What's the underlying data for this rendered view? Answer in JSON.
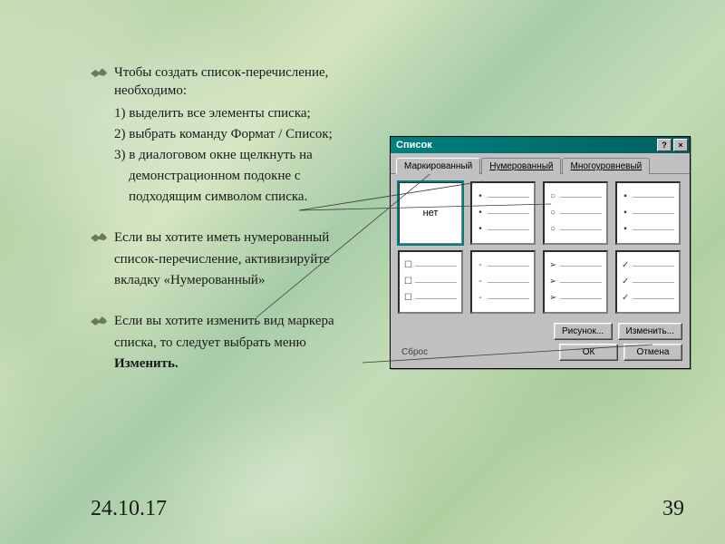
{
  "slide": {
    "bullets": [
      {
        "lead": "Чтобы создать список-перечисление, необходимо:",
        "items": [
          "1) выделить все элементы списка;",
          "2) выбрать команду Формат / Список;",
          "3) в диалоговом окне щелкнуть на"
        ],
        "items_indent": [
          "демонстрационном подокне с",
          "подходящим символом списка."
        ]
      },
      {
        "lead_lines": [
          "Если вы хотите иметь нумерованный",
          "список-перечисление, активизируйте",
          "вкладку «Нумерованный»"
        ]
      },
      {
        "lead_lines_mixed": [
          {
            "t": "Если вы хотите изменить вид маркера"
          },
          {
            "t": "списка, то следует выбрать меню"
          },
          {
            "b": "Изменить."
          }
        ]
      }
    ],
    "footer_date": "24.10.17",
    "footer_page": "39"
  },
  "dialog": {
    "title": "Список",
    "help_btn": "?",
    "close_btn": "×",
    "tabs": {
      "t1": "Маркированный",
      "t2": "Нумерованный",
      "t3": "Многоуровневый"
    },
    "thumb_none": "нет",
    "buttons": {
      "picture": "Рисунок...",
      "modify": "Изменить...",
      "reset": "Сброс",
      "ok": "ОК",
      "cancel": "Отмена"
    }
  }
}
